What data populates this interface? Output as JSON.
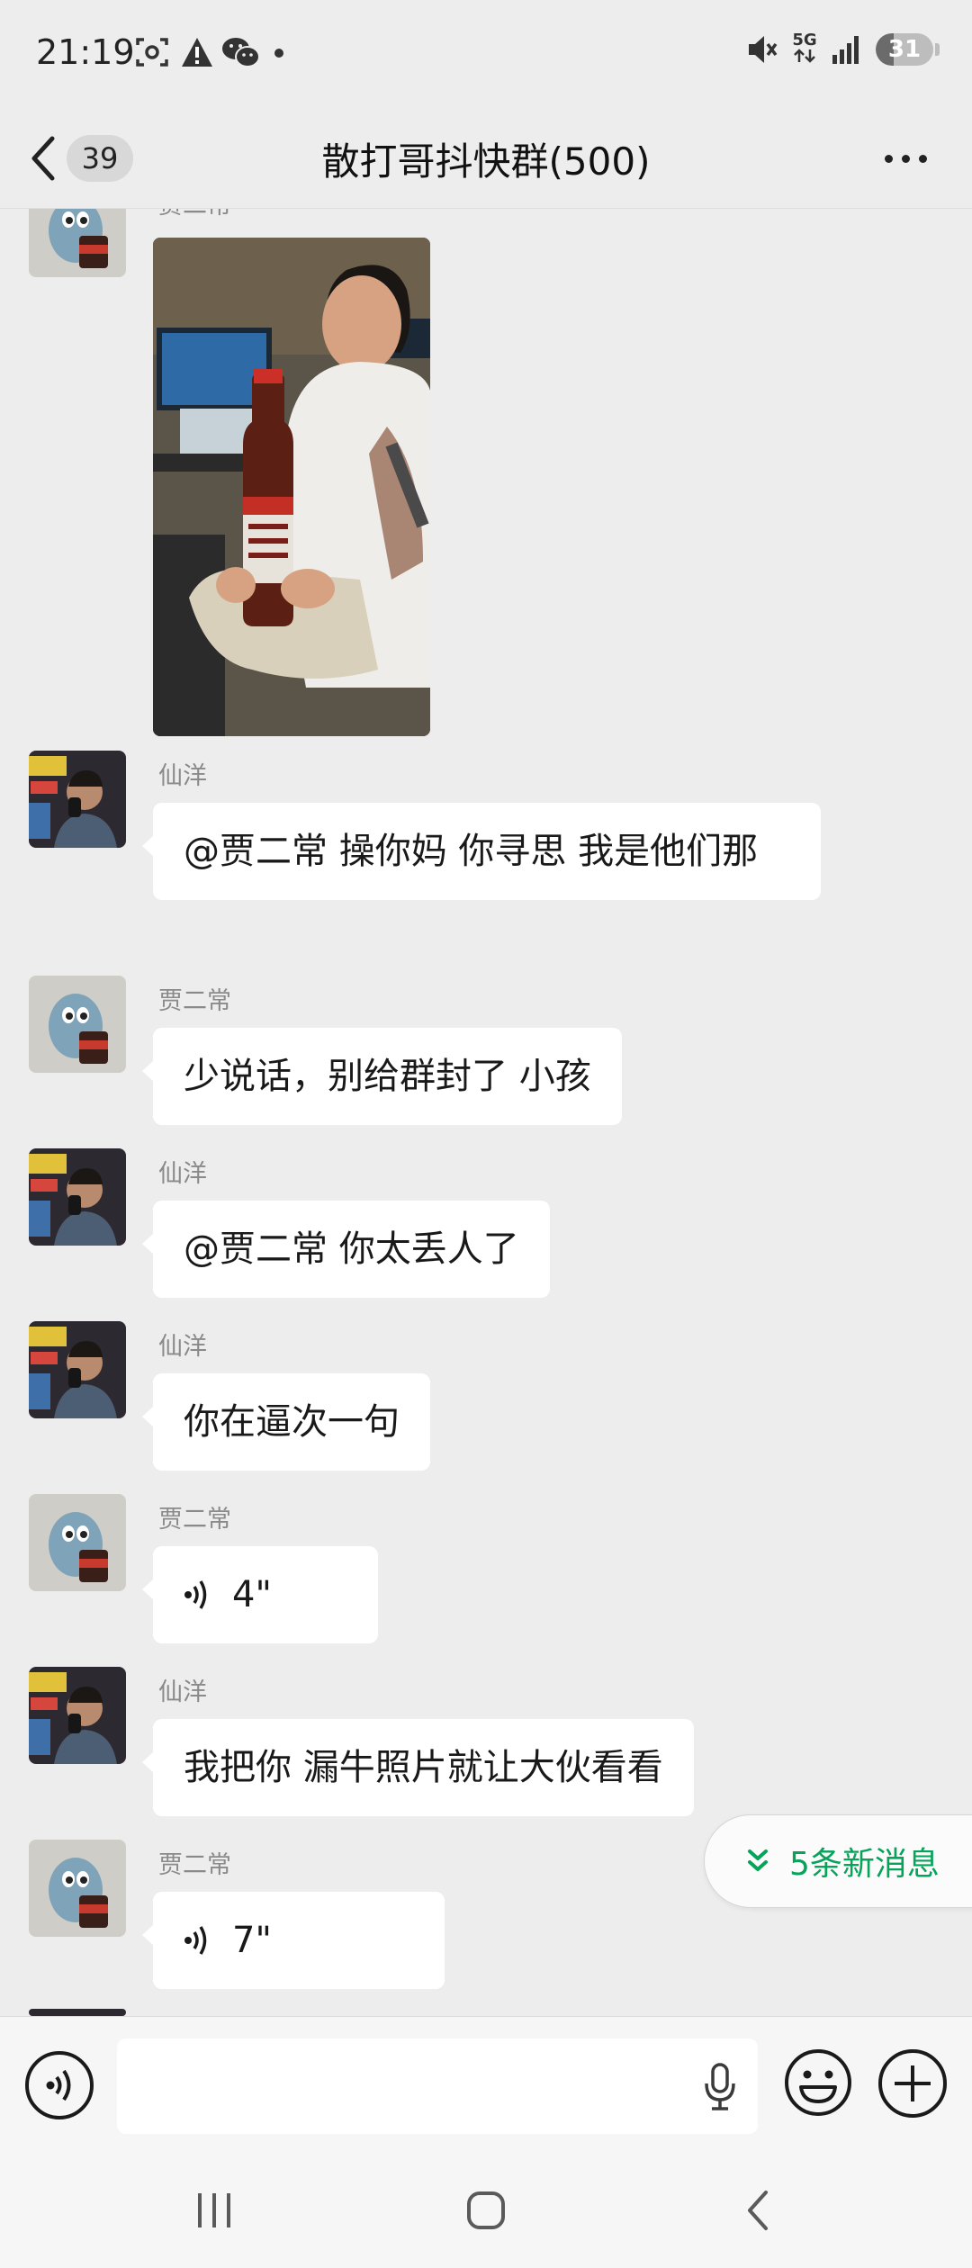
{
  "status_bar": {
    "time": "21:19",
    "network": "5G",
    "battery": "31",
    "battery_level": 0.31
  },
  "header": {
    "back_count": "39",
    "title": "散打哥抖快群(500)"
  },
  "messages": [
    {
      "type": "image",
      "sender": "贾二常"
    },
    {
      "type": "text",
      "sender": "仙洋",
      "text": "@贾二常  操你妈 你寻思 我是他们那"
    },
    {
      "type": "text",
      "sender": "贾二常",
      "text": "少说话，别给群封了 小孩"
    },
    {
      "type": "text",
      "sender": "仙洋",
      "text": "@贾二常  你太丢人了"
    },
    {
      "type": "text",
      "sender": "仙洋",
      "text": "你在逼次一句"
    },
    {
      "type": "voice",
      "sender": "贾二常",
      "duration": "4\""
    },
    {
      "type": "text",
      "sender": "仙洋",
      "text": "我把你 漏牛照片就让大伙看看"
    },
    {
      "type": "voice",
      "sender": "贾二常",
      "duration": "7\""
    }
  ],
  "new_messages": {
    "label": "5条新消息"
  },
  "colors": {
    "background": "#ededed",
    "bubble": "#ffffff",
    "accent_green": "#06a35a"
  },
  "icons": [
    "back-arrow-icon",
    "more-icon",
    "voice-icon",
    "microphone-icon",
    "emoji-icon",
    "plus-icon",
    "recent-apps-icon",
    "home-icon",
    "nav-back-icon"
  ]
}
